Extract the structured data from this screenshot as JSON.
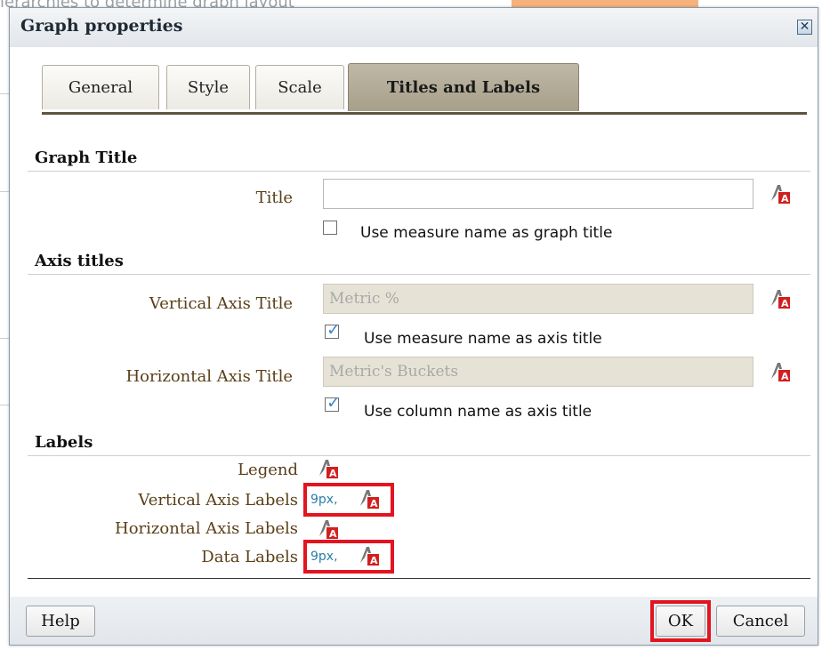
{
  "background": {
    "partial_text": "ierarchies to determine graph layout"
  },
  "dialog": {
    "title": "Graph properties",
    "close_icon": "close-icon"
  },
  "tabs": [
    {
      "label": "General",
      "active": false
    },
    {
      "label": "Style",
      "active": false
    },
    {
      "label": "Scale",
      "active": false
    },
    {
      "label": "Titles and Labels",
      "active": true
    }
  ],
  "graph_title": {
    "heading": "Graph Title",
    "title_label": "Title",
    "title_value": "",
    "use_measure_checkbox": {
      "label": "Use measure name as graph title",
      "checked": false
    }
  },
  "axis_titles": {
    "heading": "Axis titles",
    "vertical": {
      "label": "Vertical Axis Title",
      "value": "Metric %",
      "checkbox": {
        "label": "Use measure name as axis title",
        "checked": true
      }
    },
    "horizontal": {
      "label": "Horizontal Axis Title",
      "value": "Metric's Buckets",
      "checkbox": {
        "label": "Use column name as axis title",
        "checked": true
      }
    }
  },
  "labels": {
    "heading": "Labels",
    "rows": [
      {
        "label": "Legend",
        "font_size": ""
      },
      {
        "label": "Vertical Axis Labels",
        "font_size": "9px,"
      },
      {
        "label": "Horizontal Axis Labels",
        "font_size": ""
      },
      {
        "label": "Data Labels",
        "font_size": "9px,"
      }
    ]
  },
  "footer": {
    "help_label": "Help",
    "ok_label": "OK",
    "cancel_label": "Cancel"
  },
  "colors": {
    "active_tab": "#a79f89",
    "label_text": "#5a3f17",
    "highlight": "#e3141f",
    "link_blue": "#2a7fa6"
  }
}
